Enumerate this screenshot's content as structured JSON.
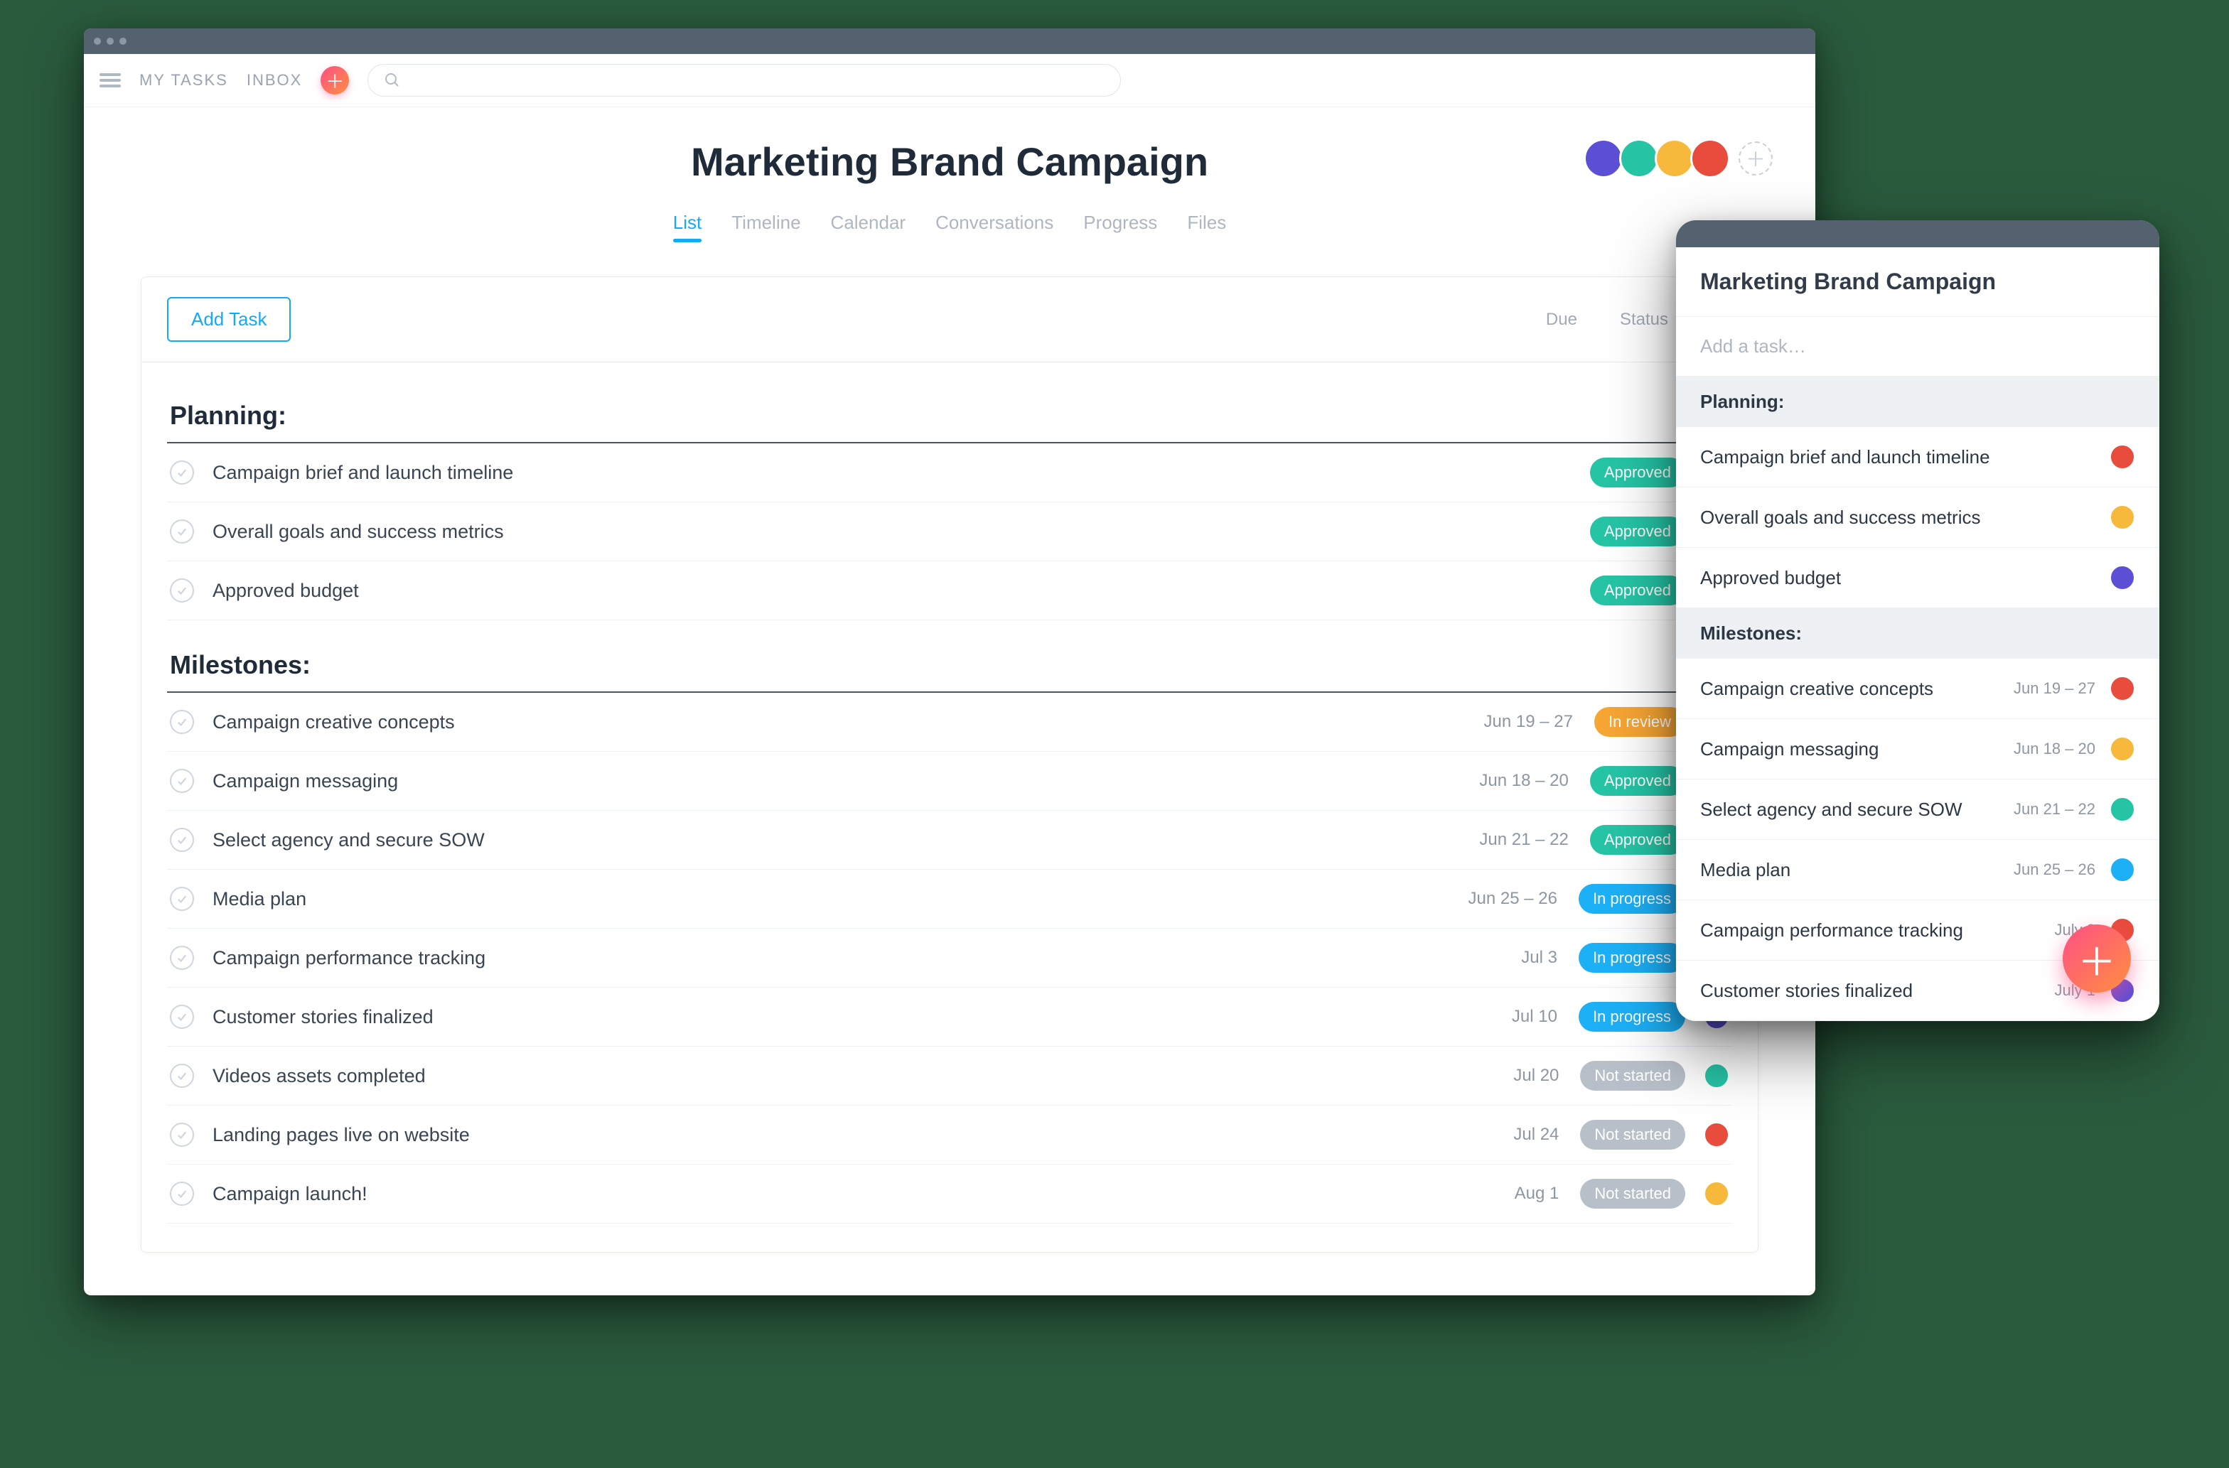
{
  "nav": {
    "my_tasks": "MY TASKS",
    "inbox": "INBOX"
  },
  "search": {
    "placeholder": ""
  },
  "project": {
    "title": "Marketing Brand Campaign",
    "member_colors": [
      "#5b4fd6",
      "#25c4a5",
      "#f6b93b",
      "#e74c3c"
    ]
  },
  "tabs": [
    "List",
    "Timeline",
    "Calendar",
    "Conversations",
    "Progress",
    "Files"
  ],
  "active_tab": 0,
  "panel": {
    "add_task": "Add Task",
    "col_due": "Due",
    "col_status": "Status"
  },
  "sections": [
    {
      "title": "Planning:",
      "tasks": [
        {
          "name": "Campaign brief and launch timeline",
          "due": "",
          "status": "Approved",
          "status_class": "b-approved",
          "avatar": "#e74c3c"
        },
        {
          "name": "Overall goals and success metrics",
          "due": "",
          "status": "Approved",
          "status_class": "b-approved",
          "avatar": "#f6b93b"
        },
        {
          "name": "Approved budget",
          "due": "",
          "status": "Approved",
          "status_class": "b-approved",
          "avatar": "#5b4fd6"
        }
      ]
    },
    {
      "title": "Milestones:",
      "tasks": [
        {
          "name": "Campaign creative concepts",
          "due": "Jun 19 – 27",
          "status": "In review",
          "status_class": "b-review",
          "avatar": "#e74c3c"
        },
        {
          "name": "Campaign messaging",
          "due": "Jun 18 – 20",
          "status": "Approved",
          "status_class": "b-approved",
          "avatar": "#f6b93b"
        },
        {
          "name": "Select agency and secure SOW",
          "due": "Jun 21 – 22",
          "status": "Approved",
          "status_class": "b-approved",
          "avatar": "#25c4a5"
        },
        {
          "name": "Media plan",
          "due": "Jun 25 – 26",
          "status": "In progress",
          "status_class": "b-progress",
          "avatar": "#1cb0f6"
        },
        {
          "name": "Campaign performance tracking",
          "due": "Jul 3",
          "status": "In progress",
          "status_class": "b-progress",
          "avatar": "#e74c3c"
        },
        {
          "name": "Customer stories finalized",
          "due": "Jul 10",
          "status": "In progress",
          "status_class": "b-progress",
          "avatar": "#5b4fd6"
        },
        {
          "name": "Videos assets completed",
          "due": "Jul 20",
          "status": "Not started",
          "status_class": "b-notstarted",
          "avatar": "#25c4a5"
        },
        {
          "name": "Landing pages live on website",
          "due": "Jul 24",
          "status": "Not started",
          "status_class": "b-notstarted",
          "avatar": "#e74c3c"
        },
        {
          "name": "Campaign launch!",
          "due": "Aug 1",
          "status": "Not started",
          "status_class": "b-notstarted",
          "avatar": "#f6b93b"
        }
      ]
    }
  ],
  "mobile": {
    "title": "Marketing Brand Campaign",
    "add_placeholder": "Add a task…",
    "sections": [
      {
        "title": "Planning:",
        "tasks": [
          {
            "name": "Campaign brief and launch timeline",
            "due": "",
            "avatar": "#e74c3c"
          },
          {
            "name": "Overall goals and success metrics",
            "due": "",
            "avatar": "#f6b93b"
          },
          {
            "name": "Approved budget",
            "due": "",
            "avatar": "#5b4fd6"
          }
        ]
      },
      {
        "title": "Milestones:",
        "tasks": [
          {
            "name": "Campaign creative concepts",
            "due": "Jun 19 – 27",
            "avatar": "#e74c3c"
          },
          {
            "name": "Campaign messaging",
            "due": "Jun 18 – 20",
            "avatar": "#f6b93b"
          },
          {
            "name": "Select agency and secure SOW",
            "due": "Jun 21 – 22",
            "avatar": "#25c4a5"
          },
          {
            "name": "Media plan",
            "due": "Jun 25 – 26",
            "avatar": "#1cb0f6"
          },
          {
            "name": "Campaign performance tracking",
            "due": "July 3",
            "avatar": "#e74c3c"
          },
          {
            "name": "Customer stories finalized",
            "due": "July 1",
            "avatar": "#5b4fd6"
          }
        ]
      }
    ]
  }
}
